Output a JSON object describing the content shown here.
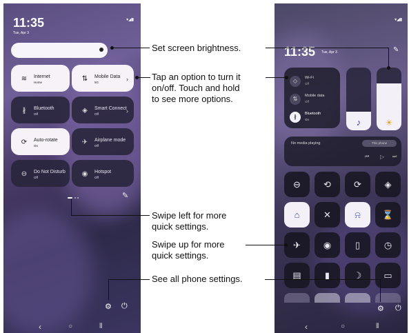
{
  "left": {
    "time": "11:35",
    "date": "Tue, Apr 3",
    "status_icons": "▾◢▮",
    "tiles": [
      {
        "label": "Internet",
        "sub": "Home",
        "icon": "≋",
        "state": "on",
        "chevron": ""
      },
      {
        "label": "Mobile Data",
        "sub": "5G",
        "icon": "⇅",
        "state": "on",
        "chevron": "›"
      },
      {
        "label": "Bluetooth",
        "sub": "Off",
        "icon": "∦",
        "state": "off",
        "chevron": ""
      },
      {
        "label": "Smart Connect",
        "sub": "Off",
        "icon": "◈",
        "state": "off",
        "chevron": "›"
      },
      {
        "label": "Auto-rotate",
        "sub": "On",
        "icon": "⟳",
        "state": "on",
        "chevron": ""
      },
      {
        "label": "Airplane mode",
        "sub": "Off",
        "icon": "✈",
        "state": "off",
        "chevron": ""
      },
      {
        "label": "Do Not Disturb",
        "sub": "Off",
        "icon": "⊖",
        "state": "off",
        "chevron": ""
      },
      {
        "label": "Hotspot",
        "sub": "Off",
        "icon": "◉",
        "state": "off",
        "chevron": ""
      }
    ],
    "edit_icon": "✎",
    "settings_icon": "⚙",
    "power_icon": "⏻",
    "nav": {
      "back": "‹",
      "home": "○",
      "recents": "⦀"
    }
  },
  "right": {
    "time": "11:35",
    "date": "Tue, Apr 3",
    "status_icons": "▾◢▮",
    "edit_icon": "✎",
    "connectivity": [
      {
        "label": "Wi-Fi",
        "sub": "Off",
        "icon": "◇"
      },
      {
        "label": "Mobile data",
        "sub": "Off",
        "icon": "⇅"
      },
      {
        "label": "Bluetooth",
        "sub": "On",
        "icon": "∦"
      }
    ],
    "volume_icon": "♪",
    "brightness_icon": "☀",
    "media": {
      "title": "No media playing",
      "chip": "This phone",
      "prev": "⏮",
      "play": "▷",
      "next": "⏭"
    },
    "grid_icons": [
      "⊖",
      "⟲",
      "⟳",
      "◈",
      "⌂",
      "✕",
      "⍾",
      "⌛",
      "✈",
      "◉",
      "▯",
      "◷",
      "▤",
      "▮",
      "☽",
      "▭"
    ],
    "settings_icon": "⚙",
    "power_icon": "⏻",
    "nav": {
      "back": "‹",
      "home": "○",
      "recents": "⦀"
    }
  },
  "callouts": {
    "brightness": "Set screen brightness.",
    "tap_line1": "Tap an option to turn it",
    "tap_line2": "on/off. Touch and hold",
    "tap_line3": "to see more options.",
    "swipe_left_line1": "Swipe left for more",
    "swipe_left_line2": "quick settings.",
    "swipe_up_line1": "Swipe up for more",
    "swipe_up_line2": "quick settings.",
    "settings": "See all phone settings."
  }
}
